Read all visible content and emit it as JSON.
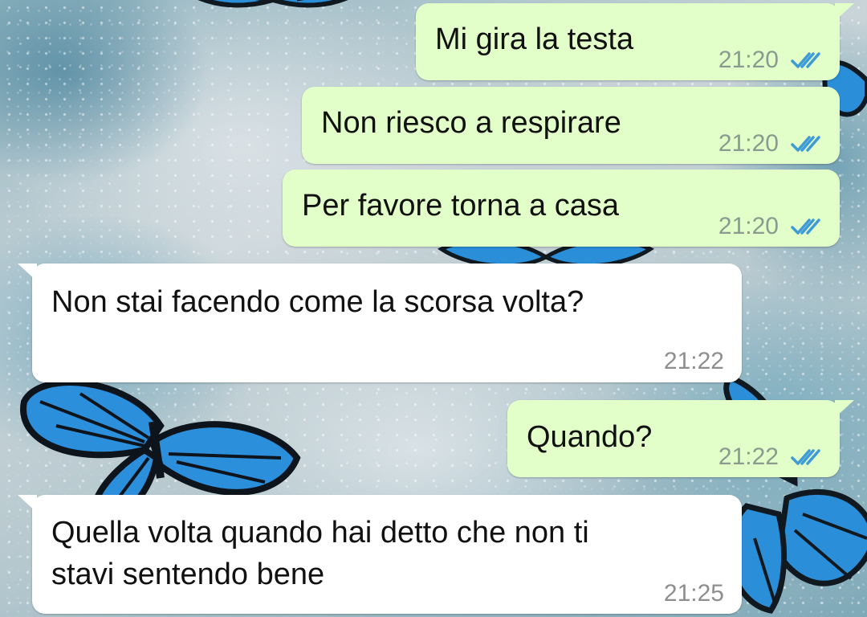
{
  "theme": {
    "outgoing_bubble": "#e2ffc9",
    "incoming_bubble": "#ffffff",
    "tick_color": "#3f9bd6",
    "wallpaper": "sparkly white and blue with blue butterflies"
  },
  "messages": [
    {
      "direction": "out",
      "text": "Mi gira la testa",
      "time": "21:20",
      "status": "read-double-tick-icon"
    },
    {
      "direction": "out",
      "text": "Non riesco a respirare",
      "time": "21:20",
      "status": "read-double-tick-icon"
    },
    {
      "direction": "out",
      "text": "Per favore torna a casa",
      "time": "21:20",
      "status": "read-double-tick-icon"
    },
    {
      "direction": "in",
      "text": "Non stai facendo come la scorsa volta?",
      "time": "21:22"
    },
    {
      "direction": "out",
      "text": "Quando?",
      "time": "21:22",
      "status": "read-double-tick-icon"
    },
    {
      "direction": "in",
      "lines": [
        "Quella volta quando hai detto che non ti",
        "stavi sentendo bene"
      ],
      "time": "21:25"
    }
  ]
}
